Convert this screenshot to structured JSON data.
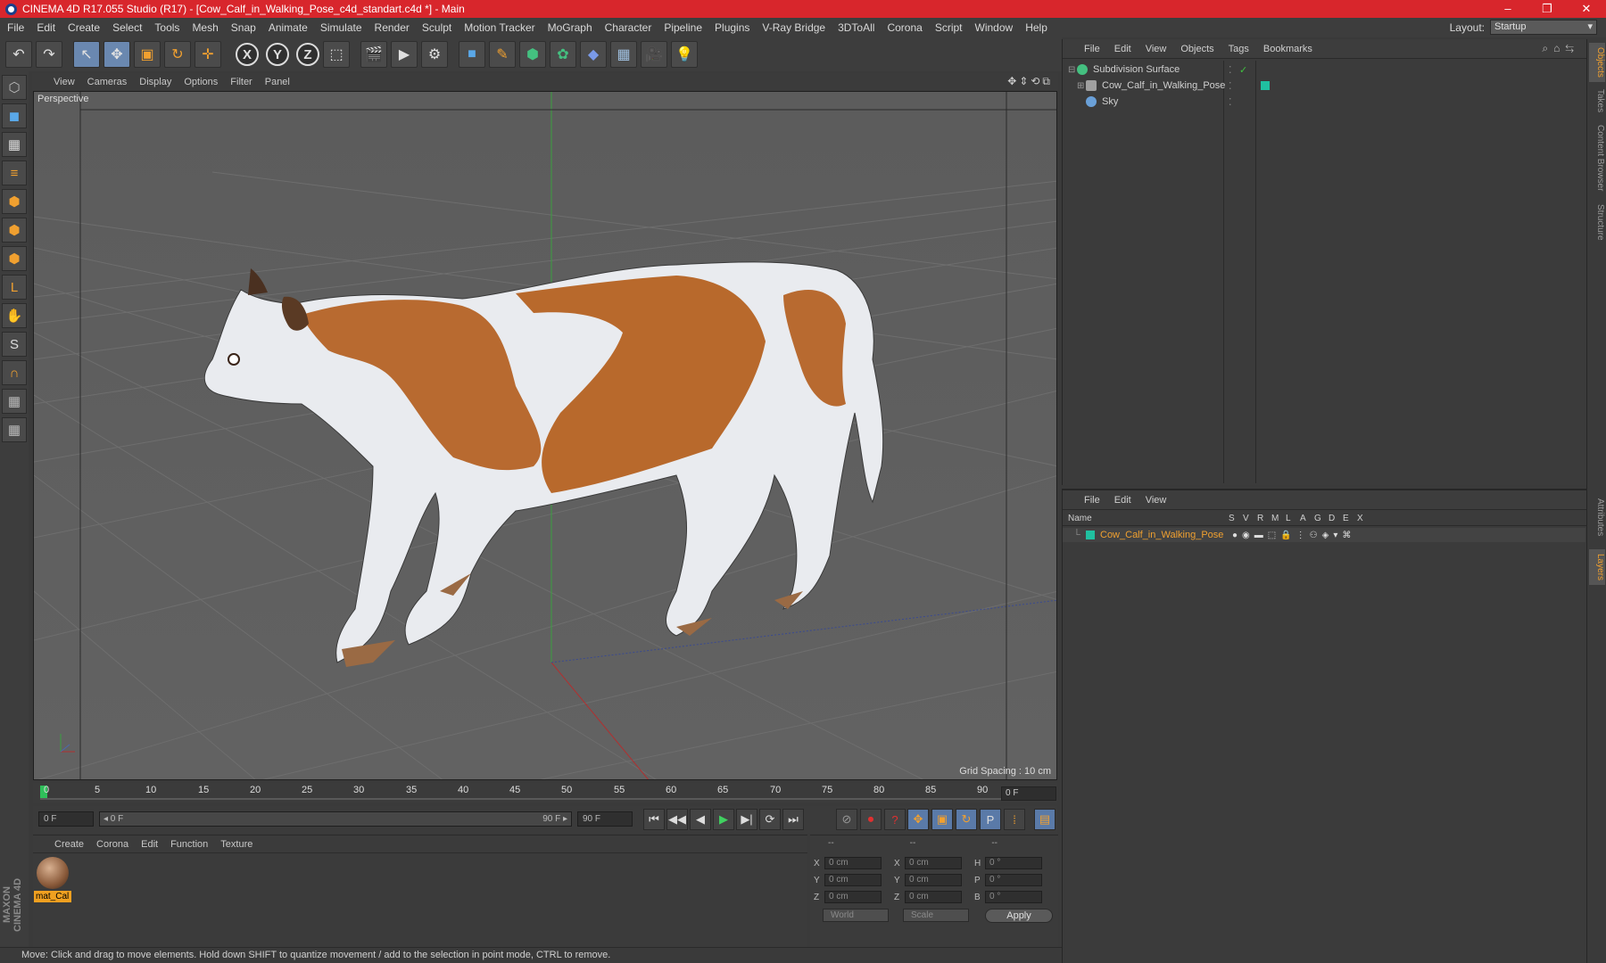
{
  "window": {
    "title": "CINEMA 4D R17.055 Studio (R17) - [Cow_Calf_in_Walking_Pose_c4d_standart.c4d *] - Main",
    "minimize": "–",
    "maximize": "❐",
    "close": "✕"
  },
  "menubar": {
    "items": [
      "File",
      "Edit",
      "Create",
      "Select",
      "Tools",
      "Mesh",
      "Snap",
      "Animate",
      "Simulate",
      "Render",
      "Sculpt",
      "Motion Tracker",
      "MoGraph",
      "Character",
      "Pipeline",
      "Plugins",
      "V-Ray Bridge",
      "3DToAll",
      "Corona",
      "Script",
      "Window",
      "Help"
    ],
    "layout_label": "Layout:",
    "layout_value": "Startup"
  },
  "toolbar": {
    "undo": "↶",
    "redo": "↷",
    "tools": [
      "↖",
      "✥",
      "▣",
      "↻",
      "✛"
    ],
    "axes": [
      "X",
      "Y",
      "Z"
    ],
    "coord": "⬚",
    "render": [
      "🎬",
      "▶",
      "⚙"
    ],
    "objects": [
      "■",
      "✎",
      "⬢",
      "✿",
      "◆",
      "▦",
      "🎥",
      "💡"
    ]
  },
  "viewport": {
    "menu": [
      "View",
      "Cameras",
      "Display",
      "Options",
      "Filter",
      "Panel"
    ],
    "nav_icons": "✥⇕⟲⧉",
    "label": "Perspective",
    "grid_spacing": "Grid Spacing : 10 cm"
  },
  "timeline": {
    "ticks": [
      "0",
      "5",
      "10",
      "15",
      "20",
      "25",
      "30",
      "35",
      "40",
      "45",
      "50",
      "55",
      "60",
      "65",
      "70",
      "75",
      "80",
      "85",
      "90"
    ],
    "current_frame": "0 F",
    "start_field": "0 F",
    "range_start": "◂ 0 F",
    "range_end": "90 F ▸",
    "end_field": "90 F",
    "playback": [
      "⏮",
      "◀◀",
      "◀",
      "▶",
      "▶|",
      "⟳",
      "⏭"
    ]
  },
  "material_manager": {
    "menu": [
      "Create",
      "Corona",
      "Edit",
      "Function",
      "Texture"
    ],
    "material_name": "mat_Cal"
  },
  "attributes": {
    "headers": [
      "--",
      "--",
      "--"
    ],
    "rows": [
      {
        "a": "X",
        "av": "0 cm",
        "b": "X",
        "bv": "0 cm",
        "c": "H",
        "cv": "0 °"
      },
      {
        "a": "Y",
        "av": "0 cm",
        "b": "Y",
        "bv": "0 cm",
        "c": "P",
        "cv": "0 °"
      },
      {
        "a": "Z",
        "av": "0 cm",
        "b": "Z",
        "bv": "0 cm",
        "c": "B",
        "cv": "0 °"
      }
    ],
    "world": "World",
    "scale": "Scale",
    "apply": "Apply"
  },
  "status": "Move: Click and drag to move elements. Hold down SHIFT to quantize movement / add to the selection in point mode, CTRL to remove.",
  "object_manager": {
    "menu": [
      "File",
      "Edit",
      "View",
      "Objects",
      "Tags",
      "Bookmarks"
    ],
    "objects": [
      {
        "name": "Subdivision Surface",
        "color": "#44c080"
      },
      {
        "name": "Cow_Calf_in_Walking_Pose",
        "color": "#a0a0a0"
      },
      {
        "name": "Sky",
        "color": "#6aa0d8"
      }
    ]
  },
  "layer_manager": {
    "menu": [
      "File",
      "Edit",
      "View"
    ],
    "columns": [
      "Name",
      "S",
      "V",
      "R",
      "M",
      "L",
      "A",
      "G",
      "D",
      "E",
      "X"
    ],
    "layer_name": "Cow_Calf_in_Walking_Pose",
    "layer_color": "#20c0a0"
  },
  "right_tabs": [
    "Objects",
    "Takes",
    "Content Browser",
    "Structure",
    "Attributes",
    "Layers"
  ],
  "maxon_logo": "MAXON CINEMA 4D"
}
